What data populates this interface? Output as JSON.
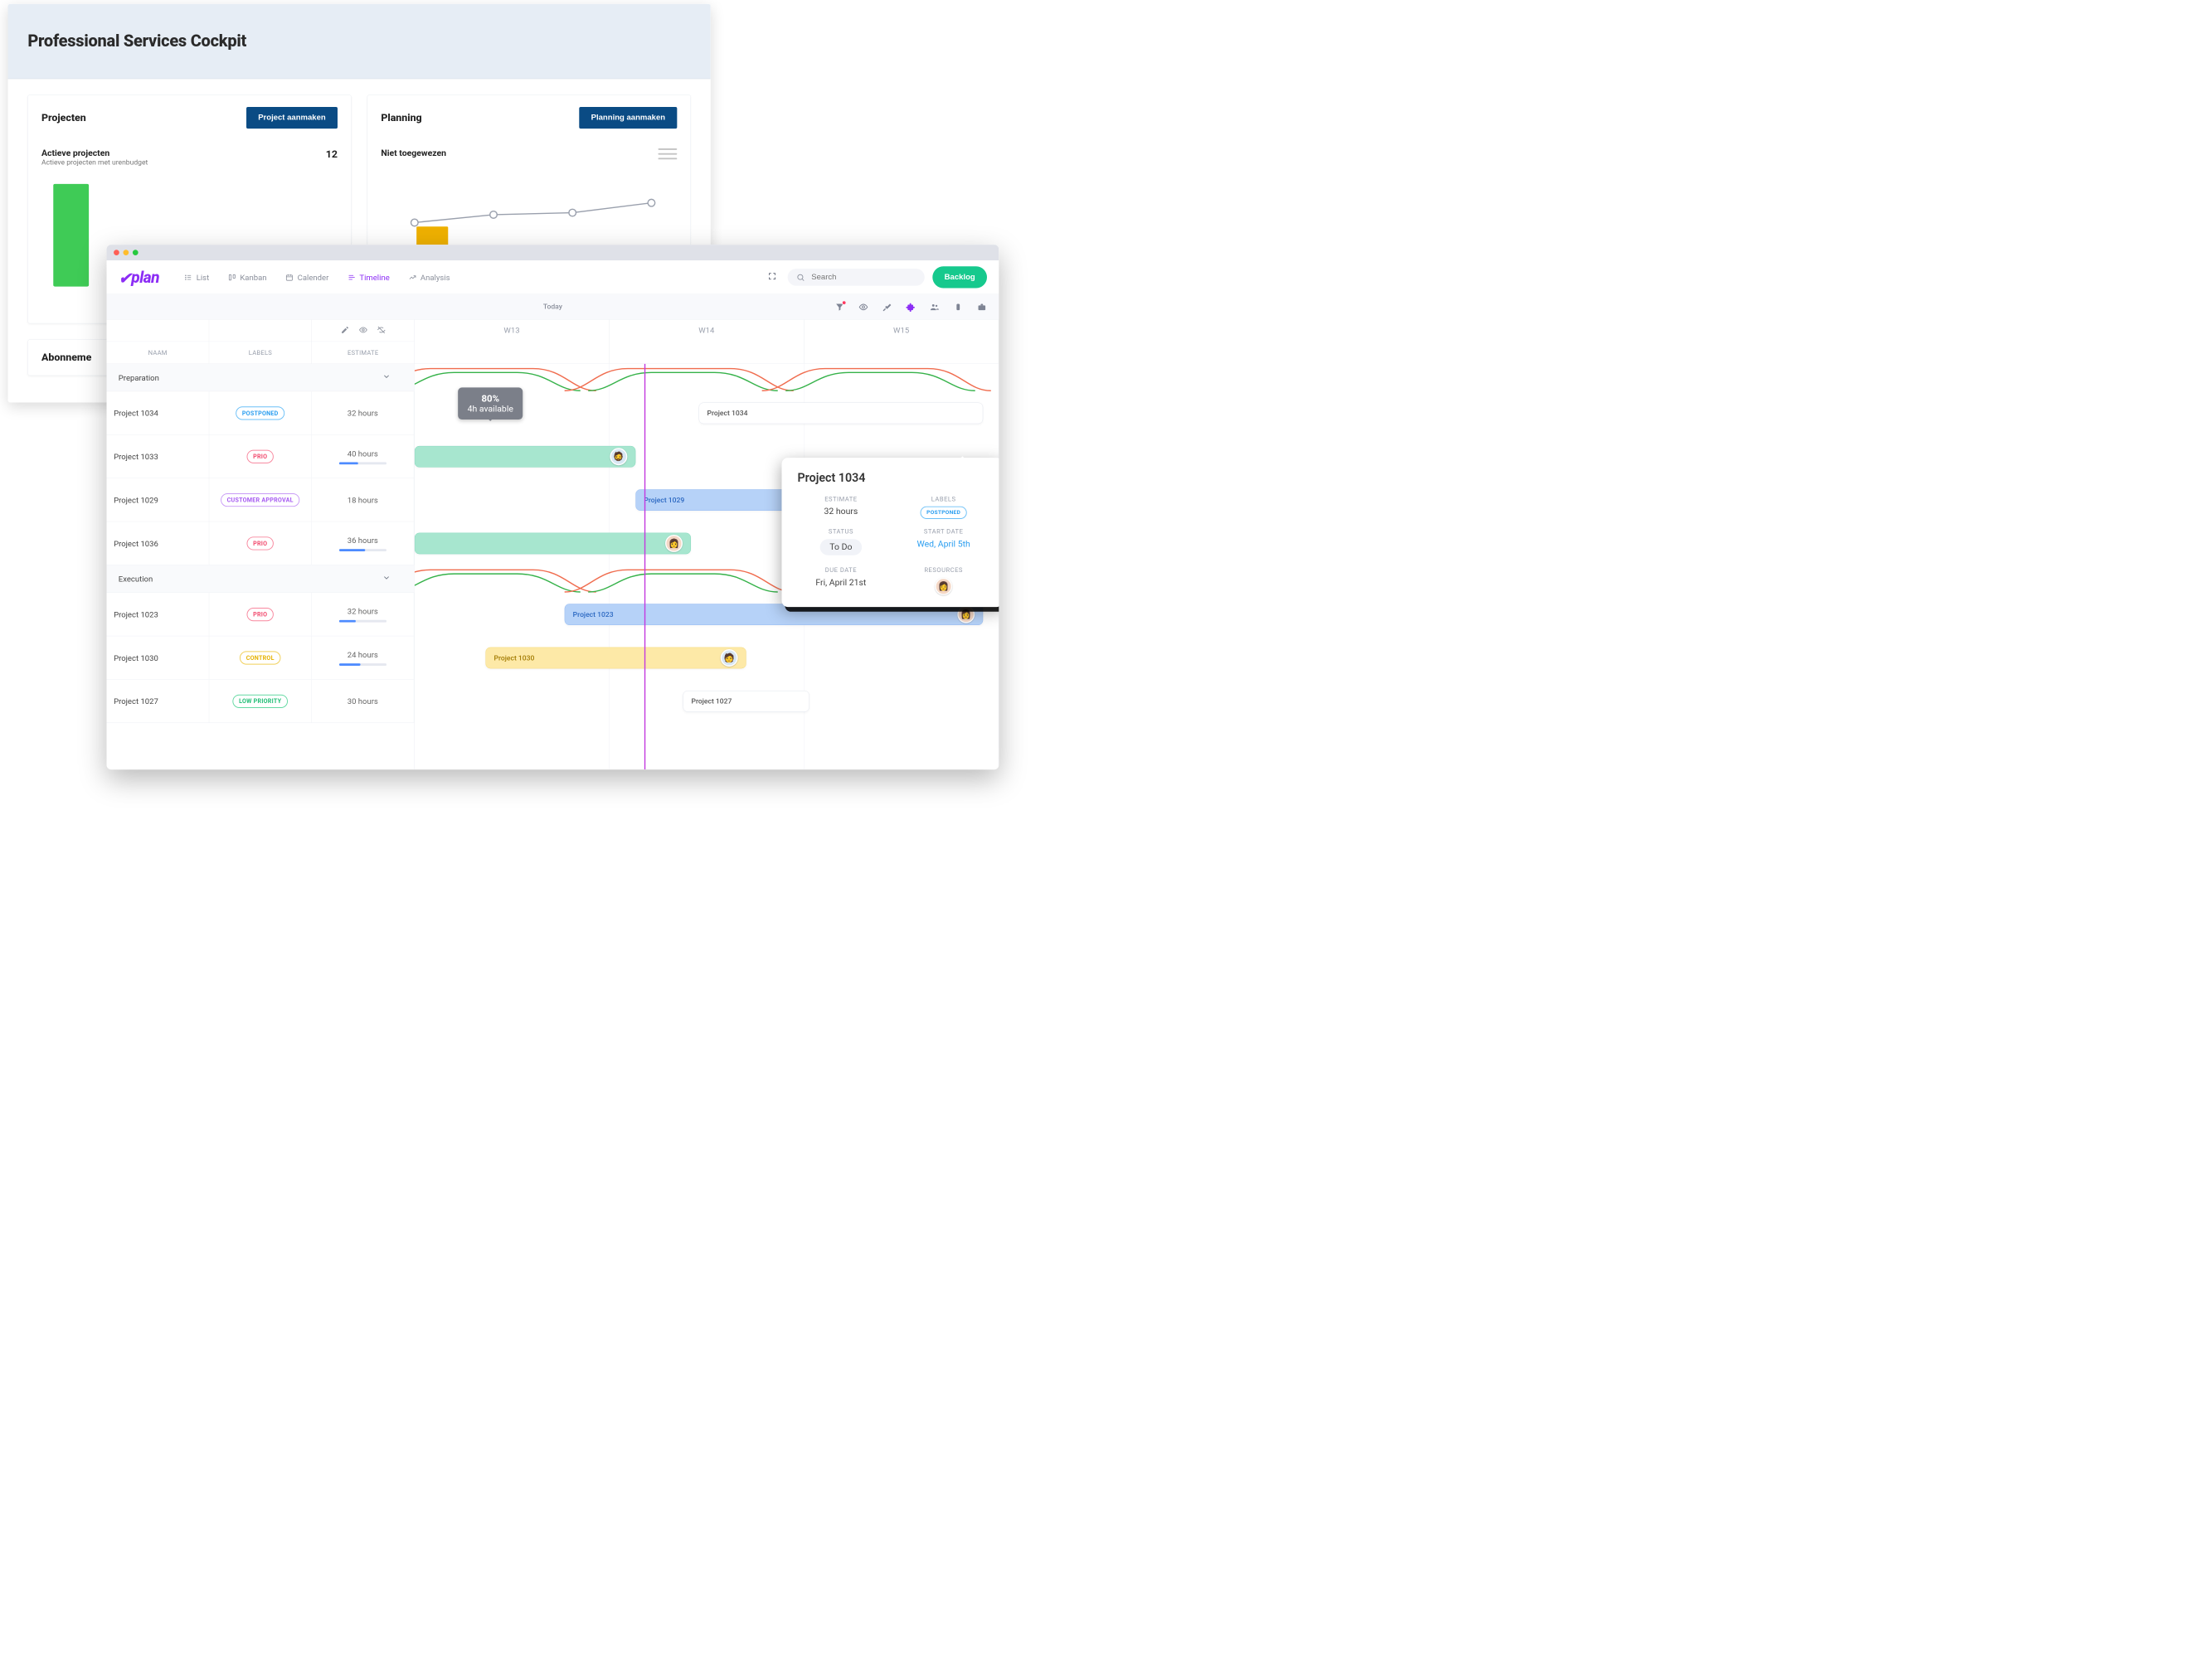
{
  "cockpit": {
    "title": "Professional Services Cockpit",
    "cards": {
      "projects": {
        "title": "Projecten",
        "button": "Project aanmaken",
        "metric_label": "Actieve projecten",
        "metric_desc": "Actieve projecten met urenbudget",
        "metric_value": "12"
      },
      "planning": {
        "title": "Planning",
        "button": "Planning aanmaken",
        "metric_label": "Niet toegewezen"
      }
    },
    "section2_title": "Abonneme"
  },
  "topbar": {
    "brand": "plan",
    "tabs": {
      "list": "List",
      "kanban": "Kanban",
      "calendar": "Calender",
      "timeline": "Timeline",
      "analysis": "Analysis"
    },
    "search_placeholder": "Search",
    "backlog": "Backlog"
  },
  "subbar": {
    "today": "Today"
  },
  "columns": {
    "name": "NAAM",
    "labels": "LABELS",
    "estimate": "ESTIMATE"
  },
  "weeks": [
    "W13",
    "W14",
    "W15"
  ],
  "sections": [
    {
      "name": "Preparation",
      "rows": [
        {
          "name": "Project 1034",
          "label": "POSTPONED",
          "label_kind": "postponed",
          "estimate": "32 hours",
          "progress": 0
        },
        {
          "name": "Project 1033",
          "label": "PRIO",
          "label_kind": "prio",
          "estimate": "40 hours",
          "progress": 40
        },
        {
          "name": "Project 1029",
          "label": "CUSTOMER APPROVAL",
          "label_kind": "customer",
          "estimate": "18 hours",
          "progress": 0
        },
        {
          "name": "Project 1036",
          "label": "PRIO",
          "label_kind": "prio",
          "estimate": "36 hours",
          "progress": 55
        }
      ]
    },
    {
      "name": "Execution",
      "rows": [
        {
          "name": "Project 1023",
          "label": "PRIO",
          "label_kind": "prio",
          "estimate": "32 hours",
          "progress": 35
        },
        {
          "name": "Project 1030",
          "label": "CONTROL",
          "label_kind": "control",
          "estimate": "24 hours",
          "progress": 45
        },
        {
          "name": "Project 1027",
          "label": "LOW PRIORITY",
          "label_kind": "low",
          "estimate": "30 hours",
          "progress": 0
        }
      ]
    }
  ],
  "tooltip": {
    "pct": "80%",
    "sub": "4h available"
  },
  "gantt": {
    "bar1034_white": "Project 1034",
    "bar1029": "Project 1029",
    "bar1023": "Project 1023",
    "bar1030": "Project 1030",
    "bar1027": "Project 1027"
  },
  "popup": {
    "title": "Project 1034",
    "fields": {
      "estimate_l": "ESTIMATE",
      "estimate_v": "32 hours",
      "labels_l": "LABELS",
      "labels_v": "POSTPONED",
      "status_l": "STATUS",
      "status_v": "To Do",
      "start_l": "START DATE",
      "start_v": "Wed, April 5th",
      "due_l": "DUE DATE",
      "due_v": "Fri, April 21st",
      "res_l": "RESOURCES"
    }
  }
}
